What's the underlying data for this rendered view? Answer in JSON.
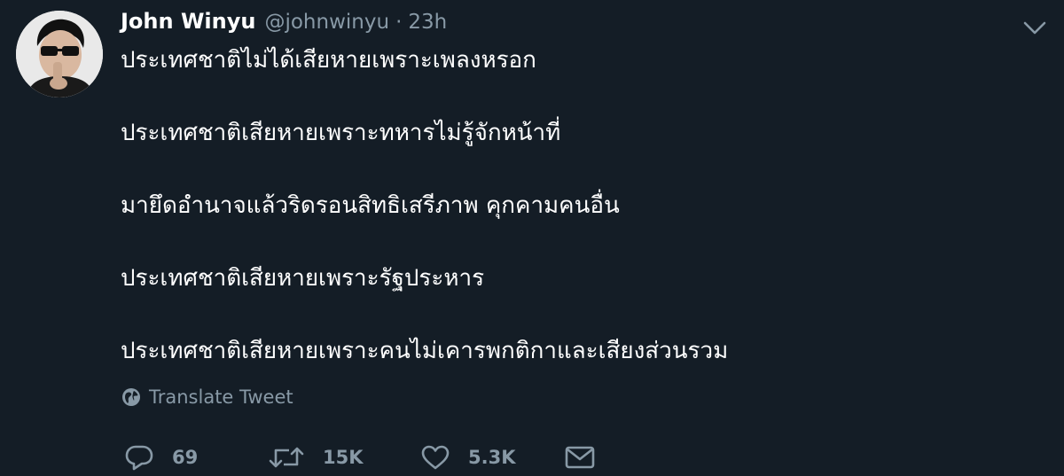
{
  "user": {
    "display_name": "John Winyu",
    "handle": "@johnwinyu",
    "separator": "·",
    "time": "23h"
  },
  "tweet": {
    "lines": [
      "ประเทศชาติไม่ได้เสียหายเพราะเพลงหรอก",
      "ประเทศชาติเสียหายเพราะทหารไม่รู้จักหน้าที่",
      "มายึดอำนาจแล้วริดรอนสิทธิเสรีภาพ คุกคามคนอื่น",
      "ประเทศชาติเสียหายเพราะรัฐประหาร",
      "ประเทศชาติเสียหายเพราะคนไม่เคารพกติกาและเสียงส่วนรวม"
    ]
  },
  "translate": {
    "label": "Translate Tweet",
    "icon": "globe-icon"
  },
  "actions": {
    "reply": {
      "icon": "reply-icon",
      "count": "69"
    },
    "retweet": {
      "icon": "retweet-icon",
      "count": "15K"
    },
    "like": {
      "icon": "heart-icon",
      "count": "5.3K"
    },
    "dm": {
      "icon": "envelope-icon"
    }
  },
  "menu": {
    "icon": "chevron-down-icon"
  },
  "colors": {
    "background": "#141d26",
    "text": "#ffffff",
    "muted": "#8899a6"
  }
}
